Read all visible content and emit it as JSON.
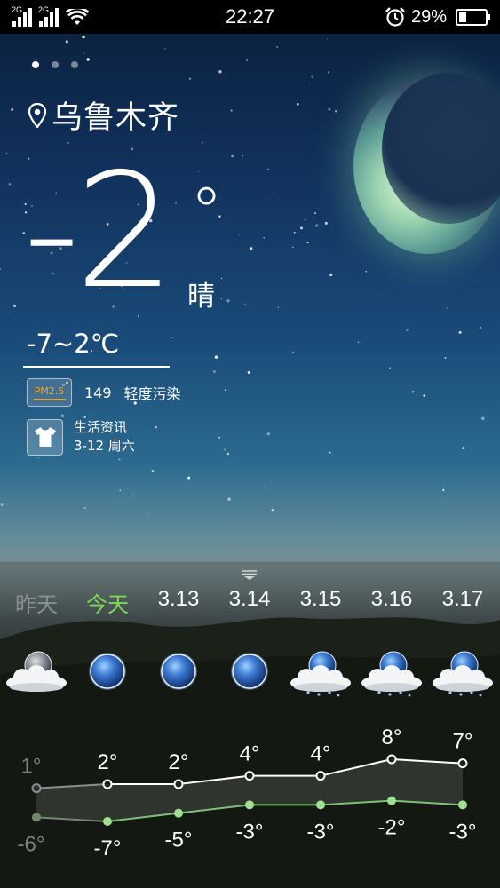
{
  "status_bar": {
    "sim1_label": "2G",
    "sim2_label": "2G",
    "time": "22:27",
    "battery_text": "29%",
    "battery_level": 0.29,
    "icons": [
      "signal-icon",
      "signal-icon",
      "wifi-icon",
      "alarm-icon",
      "battery-icon"
    ]
  },
  "pager": {
    "pages": 3,
    "active": 0
  },
  "location": {
    "city": "乌鲁木齐",
    "icon": "location-pin-icon"
  },
  "current": {
    "temperature": "-2",
    "degree_symbol": "°",
    "condition": "晴",
    "range": "-7~2℃"
  },
  "air_quality": {
    "badge": "PM2.5",
    "value": "149",
    "level": "轻度污染",
    "accent_color": "#e7a531"
  },
  "life_info": {
    "title": "生活资讯",
    "date": "3-12 周六",
    "icon": "shirt-icon"
  },
  "forecast": {
    "days": [
      {
        "label": "昨天",
        "icon": "cloudy-night-icon",
        "state": "past"
      },
      {
        "label": "今天",
        "icon": "clear-night-icon",
        "state": "today"
      },
      {
        "label": "3.13",
        "icon": "clear-night-icon",
        "state": "future"
      },
      {
        "label": "3.14",
        "icon": "clear-night-icon",
        "state": "future"
      },
      {
        "label": "3.15",
        "icon": "snowy-night-icon",
        "state": "future"
      },
      {
        "label": "3.16",
        "icon": "snowy-night-icon",
        "state": "future"
      },
      {
        "label": "3.17",
        "icon": "snowy-night-icon",
        "state": "future"
      }
    ],
    "today_color": "#7ed957",
    "past_color": "#8a8f90"
  },
  "chart_data": {
    "type": "line",
    "x": [
      "昨天",
      "今天",
      "3.13",
      "3.14",
      "3.15",
      "3.16",
      "3.17"
    ],
    "series": [
      {
        "values": [
          1,
          2,
          2,
          4,
          4,
          8,
          7
        ],
        "labels": [
          "1°",
          "2°",
          "2°",
          "4°",
          "4°",
          "8°",
          "7°"
        ]
      },
      {
        "values": [
          -6,
          -7,
          -5,
          -3,
          -3,
          -2,
          -3
        ],
        "labels": [
          "-6°",
          "-7°",
          "-5°",
          "-3°",
          "-3°",
          "-2°",
          "-3°"
        ]
      }
    ],
    "grid": false,
    "legend": "none"
  }
}
